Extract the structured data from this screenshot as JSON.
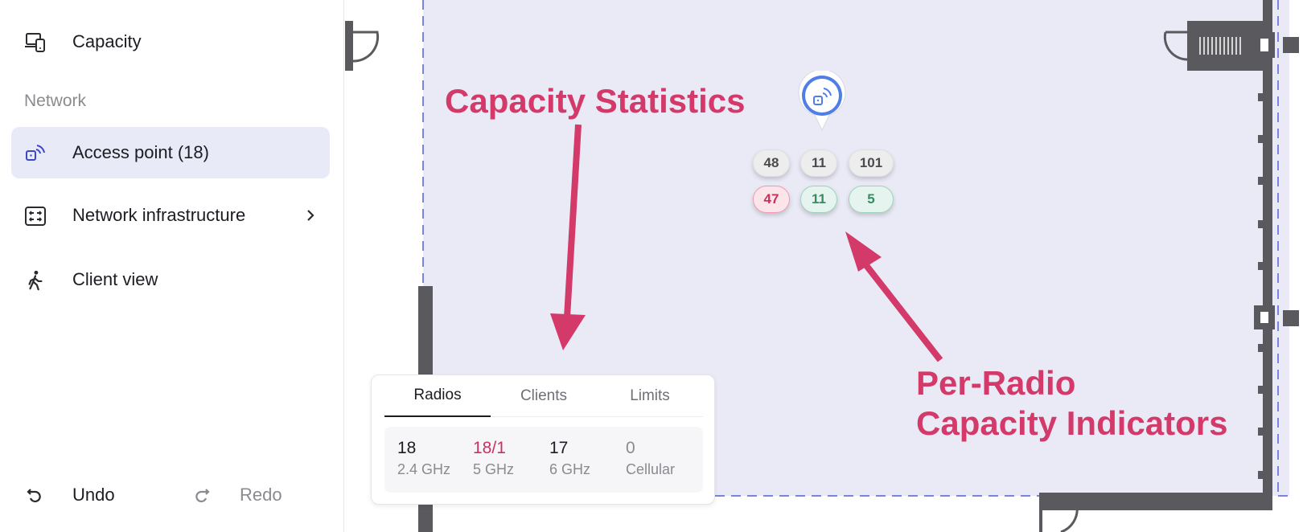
{
  "sidebar": {
    "capacity": {
      "label": "Capacity",
      "icon": "devices-icon"
    },
    "section_network": "Network",
    "access_point": {
      "label": "Access point (18)",
      "icon": "access-point-icon"
    },
    "network_infrastructure": {
      "label": "Network infrastructure",
      "icon": "network-switch-icon"
    },
    "client_view": {
      "label": "Client view",
      "icon": "walking-person-icon"
    },
    "undo": {
      "label": "Undo",
      "icon": "undo-icon"
    },
    "redo": {
      "label": "Redo",
      "icon": "redo-icon"
    }
  },
  "annotations": {
    "capacity_statistics": "Capacity Statistics",
    "per_radio_line1": "Per-Radio",
    "per_radio_line2": "Capacity Indicators"
  },
  "ap_chips": {
    "top": [
      "48",
      "11",
      "101"
    ],
    "bottom": [
      "47",
      "11",
      "5"
    ]
  },
  "stats_panel": {
    "tabs": [
      "Radios",
      "Clients",
      "Limits"
    ],
    "active_tab": "Radios",
    "stats": [
      {
        "value": "18",
        "unit": "2.4 GHz"
      },
      {
        "value": "18/1",
        "unit": "5 GHz"
      },
      {
        "value": "17",
        "unit": "6 GHz"
      },
      {
        "value": "0",
        "unit": "Cellular"
      }
    ]
  },
  "colors": {
    "accent": "#d33a6a",
    "floor_fill": "#eaeaf7",
    "wall": "#5a5a5e",
    "ap_blue": "#4f7ee6",
    "active_row": "#e9eaf8"
  }
}
